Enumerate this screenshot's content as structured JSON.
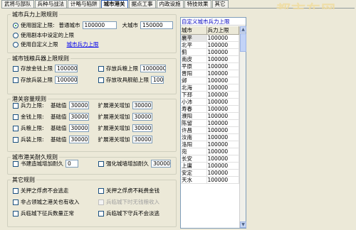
{
  "tabs": [
    "武将与部队",
    "兵种与战法",
    "计略与陷阱",
    "城市港关",
    "据点工事",
    "内政设施",
    "特技效果",
    "其它"
  ],
  "active_tab_index": 3,
  "watermark": "都市车网",
  "city_limit": {
    "legend": "城市兵力上限规则",
    "opt_fixed": "使用固定上限:",
    "normal_city_label": "普通城市",
    "normal_city_value": "100000",
    "big_city_label": "大城市",
    "big_city_value": "150000",
    "opt_script": "使用剧本中设定的上限",
    "opt_custom": "使用自定义上限",
    "custom_link": "城市兵力上限"
  },
  "weapon_limit": {
    "legend": "城市钱粮兵器上限规则",
    "gold_label": "存放金钱上限",
    "gold_value": "100000",
    "food_label": "存放兵粮上限",
    "food_value": "1000000",
    "weapon_label": "存放兵装上限",
    "weapon_value": "100000",
    "siege_label": "存放攻具舰船上限",
    "siege_value": "100"
  },
  "pass_capacity": {
    "legend": "港关容量规则",
    "base_label": "基础值",
    "extra_label": "扩展港关增加",
    "rows": [
      {
        "label": "兵力上限:",
        "base": "30000",
        "extra": "30000"
      },
      {
        "label": "金钱上限:",
        "base": "30000",
        "extra": "30000"
      },
      {
        "label": "兵粮上限:",
        "base": "30000",
        "extra": "30000"
      },
      {
        "label": "兵装上限:",
        "base": "30000",
        "extra": "30000"
      }
    ]
  },
  "durability": {
    "legend": "城市港关耐久规则",
    "build_label": "书建造城增加耐久",
    "build_value": "0",
    "wall_label": "强化城墙增加耐久",
    "wall_value": "30000"
  },
  "misc": {
    "legend": "其它规则",
    "items": [
      "关押之俘虏不会逃走",
      "关押之俘虏不耗费金钱",
      "非占领城之港关也有收入",
      "兵临城下时无钱粮收入",
      "兵临城下征兵数量正常",
      "兵临城下守兵不会淡逃"
    ],
    "checked": [
      false,
      false,
      false,
      false,
      false,
      false
    ],
    "disabled": [
      false,
      false,
      false,
      true,
      false,
      false
    ]
  },
  "custom_table": {
    "title": "自定义城市兵力上限",
    "col_city": "城市",
    "col_limit": "兵力上限",
    "rows": [
      [
        "襄平",
        "100000"
      ],
      [
        "北平",
        "100000"
      ],
      [
        "蓟",
        "100000"
      ],
      [
        "南皮",
        "100000"
      ],
      [
        "平原",
        "100000"
      ],
      [
        "晋阳",
        "100000"
      ],
      [
        "邺",
        "100000"
      ],
      [
        "北海",
        "100000"
      ],
      [
        "下邳",
        "100000"
      ],
      [
        "小沛",
        "100000"
      ],
      [
        "寿春",
        "100000"
      ],
      [
        "濮阳",
        "100000"
      ],
      [
        "陈留",
        "100000"
      ],
      [
        "许昌",
        "100000"
      ],
      [
        "汝南",
        "100000"
      ],
      [
        "洛阳",
        "100000"
      ],
      [
        "宛",
        "100000"
      ],
      [
        "长安",
        "100000"
      ],
      [
        "上庸",
        "100000"
      ],
      [
        "安定",
        "100000"
      ],
      [
        "天水",
        "100000"
      ]
    ]
  }
}
